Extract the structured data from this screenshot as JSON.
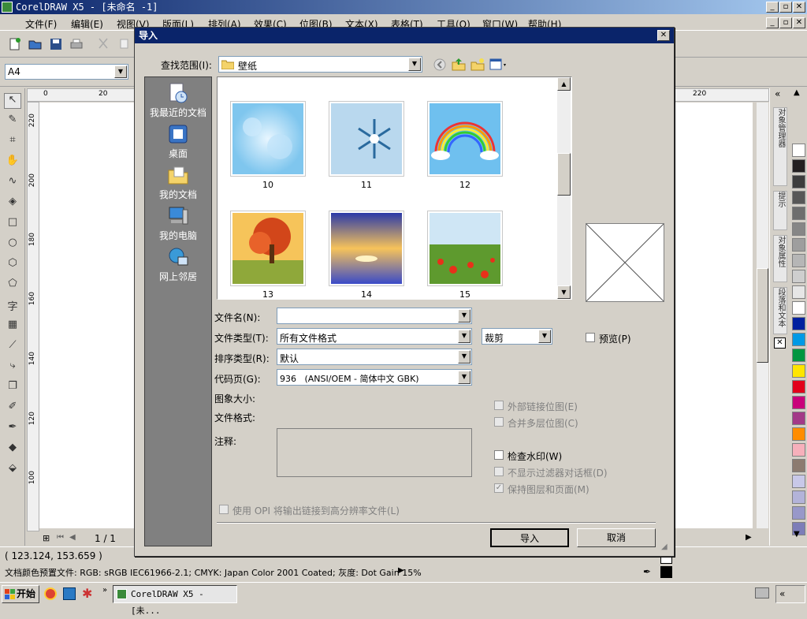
{
  "app": {
    "title": "CorelDRAW X5 - [未命名 -1]",
    "menu": [
      "文件(F)",
      "编辑(E)",
      "视图(V)",
      "版面(L)",
      "排列(A)",
      "效果(C)",
      "位图(B)",
      "文本(X)",
      "表格(T)",
      "工具(O)",
      "窗口(W)",
      "帮助(H)"
    ],
    "page_size": "A4",
    "ruler_h": [
      "0",
      "20",
      "220"
    ],
    "ruler_v": [
      "220",
      "200",
      "180",
      "160",
      "140",
      "120",
      "100"
    ],
    "page_counter": "1 / 1",
    "dockers": [
      "对象管理器",
      "提示",
      "对象属性",
      "段落和文本"
    ]
  },
  "status": {
    "coords": "( 123.124, 153.659 )",
    "color_profile": "文档颜色预置文件: RGB: sRGB IEC61966-2.1; CMYK: Japan Color 2001 Coated; 灰度: Dot Gain 15%"
  },
  "taskbar": {
    "start": "开始",
    "task": "CorelDRAW X5 - [未..."
  },
  "palette": [
    "#ffffff",
    "#231f20",
    "#3d3d3d",
    "#575757",
    "#6e6e6e",
    "#868686",
    "#9e9e9e",
    "#b6b6b6",
    "#cecece",
    "#e6e6e6",
    "#ffffff",
    "#00209f",
    "#0099e5",
    "#009640",
    "#ffe500",
    "#e2001a",
    "#c9007a",
    "#a33988",
    "#ff8c00",
    "#f6b0bb",
    "#8c7b70",
    "#c8c8e8",
    "#b3b3d9",
    "#9898c9",
    "#7d7db8"
  ],
  "dialog": {
    "title": "导入",
    "look_in_label": "查找范围(I):",
    "look_in_value": "壁纸",
    "places": [
      "我最近的文档",
      "桌面",
      "我的文档",
      "我的电脑",
      "网上邻居"
    ],
    "files": [
      "10",
      "11",
      "12",
      "13",
      "14",
      "15"
    ],
    "filename_label": "文件名(N):",
    "filename_value": "",
    "filetype_label": "文件类型(T):",
    "filetype_value": "所有文件格式",
    "sort_label": "排序类型(R):",
    "sort_value": "默认",
    "codepage_label": "代码页(G):",
    "codepage_value": "936   (ANSI/OEM - 简体中文 GBK)",
    "crop_value": "裁剪",
    "preview_label": "预览(P)",
    "image_size_label": "图象大小:",
    "file_format_label": "文件格式:",
    "notes_label": "注释:",
    "external_link": "外部链接位图(E)",
    "combine_layers": "合并多层位图(C)",
    "check_watermark": "检查水印(W)",
    "no_filter_dialog": "不显示过滤器对话框(D)",
    "keep_layers": "保持图层和页面(M)",
    "opi_option": "使用 OPI 将输出链接到高分辨率文件(L)",
    "import_button": "导入",
    "cancel_button": "取消"
  }
}
